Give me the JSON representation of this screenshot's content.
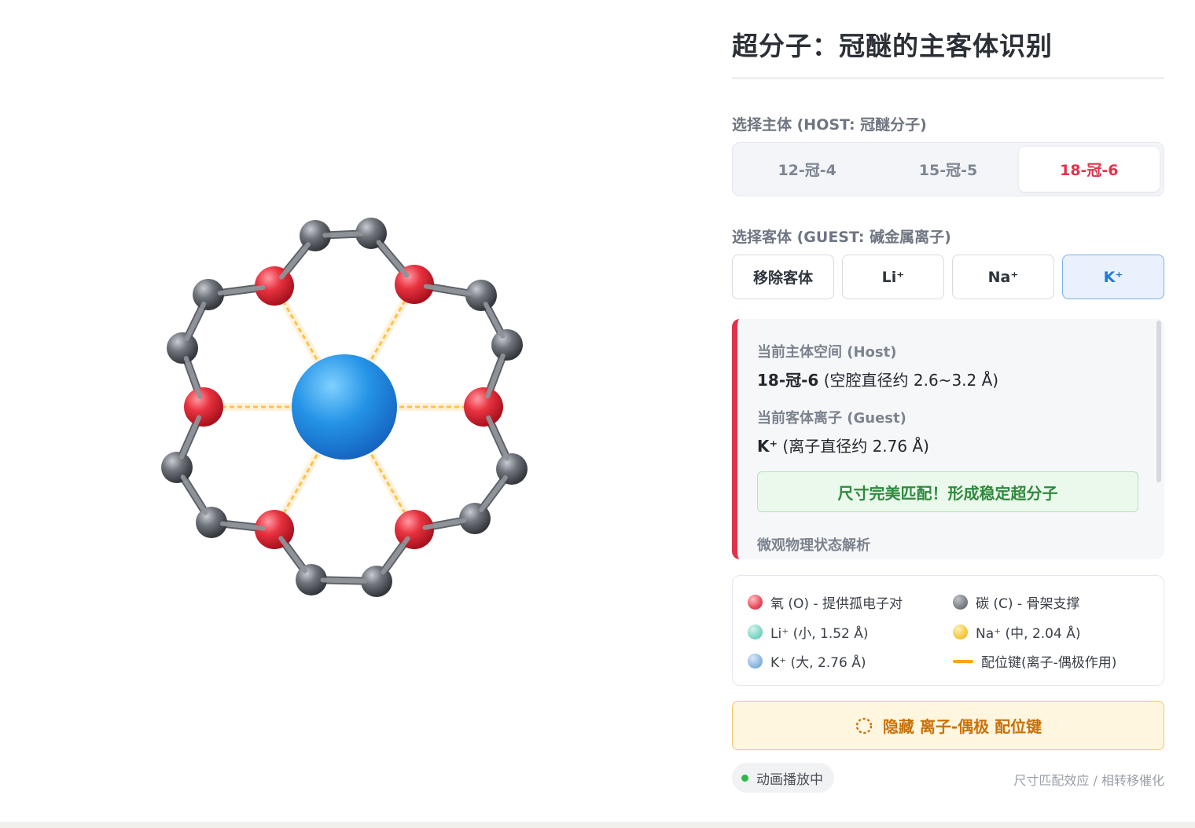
{
  "title": "超分子：冠醚的主客体识别",
  "host_section": {
    "label": "选择主体 (HOST: 冠醚分子)",
    "tabs": [
      {
        "label": "12-冠-4",
        "active": false
      },
      {
        "label": "15-冠-5",
        "active": false
      },
      {
        "label": "18-冠-6",
        "active": true
      }
    ]
  },
  "guest_section": {
    "label": "选择客体 (GUEST: 碱金属离子)",
    "buttons": [
      {
        "label": "移除客体",
        "active": false
      },
      {
        "label": "Li⁺",
        "active": false
      },
      {
        "label": "Na⁺",
        "active": false
      },
      {
        "label": "K⁺",
        "active": true
      }
    ]
  },
  "info": {
    "host_label": "当前主体空间 (Host)",
    "host_name": "18-冠-6",
    "host_detail": "(空腔直径约 2.6~3.2 Å)",
    "guest_label": "当前客体离子 (Guest)",
    "guest_name": "K⁺",
    "guest_detail": "(离子直径约 2.76 Å)",
    "match_text": "尺寸完美匹配！形成稳定超分子",
    "next_section": "微观物理状态解析"
  },
  "legend": {
    "items": [
      {
        "label": "氧 (O) - 提供孤电子对",
        "color": "#e84a5a"
      },
      {
        "label": "碳 (C) - 骨架支撑",
        "color": "#7b7f87"
      },
      {
        "label": "Li⁺ (小, 1.52 Å)",
        "color": "#7fd6c4"
      },
      {
        "label": "Na⁺ (中, 2.04 Å)",
        "color": "#f6c945"
      },
      {
        "label": "K⁺ (大, 2.76 Å)",
        "color": "#8ab6e0"
      },
      {
        "label": "配位键(离子-偶极作用)",
        "color": "#ffa31a"
      }
    ]
  },
  "toggle": {
    "label": "隐藏 离子-偶极 配位键",
    "icon": "dashed-circle-icon"
  },
  "status": {
    "label": "动画播放中",
    "color": "#2fb84a"
  },
  "footer_note": "尺寸匹配效应 / 相转移催化",
  "molecule": {
    "host": "18-冠-6",
    "guest": "K⁺",
    "oxygen_count": 6,
    "carbon_count": 12,
    "coordination_bonds_visible": true,
    "colors": {
      "oxygen": "#e03040",
      "carbon": "#6a6e76",
      "guest": "#1f88e0",
      "bond": "#8e9299",
      "coordination": "#ffb830"
    }
  }
}
